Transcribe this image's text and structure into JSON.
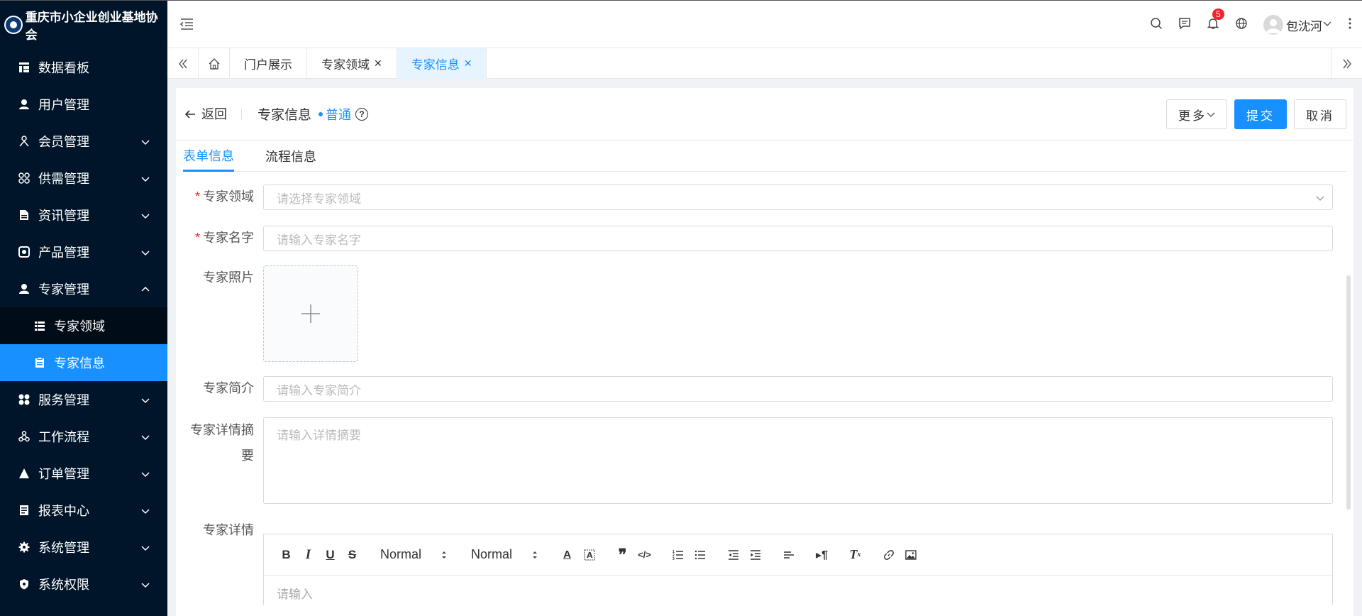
{
  "app": {
    "title": "重庆市小企业创业基地协会"
  },
  "sidebar": {
    "items": [
      {
        "label": "数据看板",
        "icon": "dashboard-icon",
        "expandable": false
      },
      {
        "label": "用户管理",
        "icon": "user-icon",
        "expandable": false
      },
      {
        "label": "会员管理",
        "icon": "member-icon",
        "expandable": true
      },
      {
        "label": "供需管理",
        "icon": "supply-icon",
        "expandable": true
      },
      {
        "label": "资讯管理",
        "icon": "news-icon",
        "expandable": true
      },
      {
        "label": "产品管理",
        "icon": "product-icon",
        "expandable": true
      },
      {
        "label": "专家管理",
        "icon": "expert-icon",
        "expandable": true,
        "expanded": true
      }
    ],
    "subitems": [
      {
        "label": "专家领域",
        "icon": "list-icon"
      },
      {
        "label": "专家信息",
        "icon": "clipboard-icon",
        "active": true
      }
    ],
    "items_after": [
      {
        "label": "服务管理",
        "icon": "service-icon"
      },
      {
        "label": "工作流程",
        "icon": "workflow-icon"
      },
      {
        "label": "订单管理",
        "icon": "order-icon"
      },
      {
        "label": "报表中心",
        "icon": "report-icon"
      },
      {
        "label": "系统管理",
        "icon": "settings-icon"
      },
      {
        "label": "系统权限",
        "icon": "shield-icon"
      }
    ]
  },
  "header": {
    "notification_count": "5",
    "user_name": "包沈河"
  },
  "tabs": [
    {
      "label": "门户展示",
      "closable": false
    },
    {
      "label": "专家领域",
      "closable": true
    },
    {
      "label": "专家信息",
      "closable": true,
      "active": true
    }
  ],
  "page": {
    "back_label": "返回",
    "title": "专家信息",
    "status": "普通",
    "more_label": "更多",
    "submit_label": "提交",
    "cancel_label": "取消",
    "inner_tabs": [
      "表单信息",
      "流程信息"
    ]
  },
  "form": {
    "domain": {
      "label": "专家领域",
      "required": true,
      "placeholder": "请选择专家领域"
    },
    "name": {
      "label": "专家名字",
      "required": true,
      "placeholder": "请输入专家名字"
    },
    "photo": {
      "label": "专家照片"
    },
    "intro": {
      "label": "专家简介",
      "placeholder": "请输入专家简介"
    },
    "summary": {
      "label_line1": "专家详情摘",
      "label_line2": "要",
      "placeholder": "请输入详情摘要"
    },
    "detail": {
      "label": "专家详情",
      "placeholder": "请输入"
    },
    "editor": {
      "header_select": "Normal",
      "size_select": "Normal"
    }
  },
  "colors": {
    "sidebar_bg": "#001529",
    "accent": "#1890ff",
    "badge": "#f5222d"
  }
}
